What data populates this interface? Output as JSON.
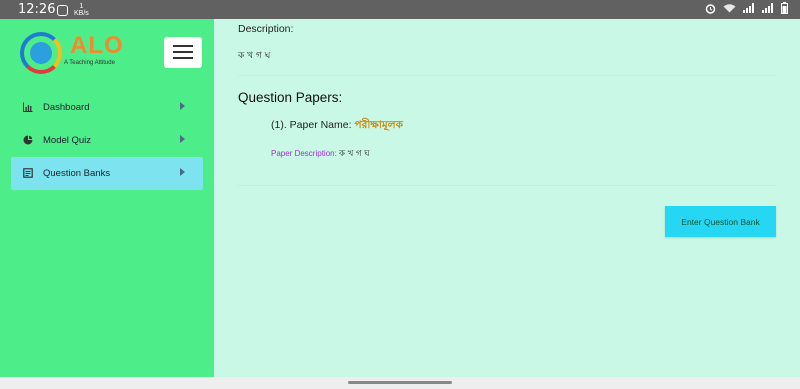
{
  "status": {
    "time": "12:26",
    "data_speed": "1\nKB/s"
  },
  "sidebar": {
    "logo_text": "ALO",
    "logo_tagline": "A Teaching Attitude",
    "items": [
      {
        "label": "Dashboard",
        "icon": "bar-chart-icon"
      },
      {
        "label": "Model Quiz",
        "icon": "pie-chart-icon"
      },
      {
        "label": "Question Banks",
        "icon": "document-icon",
        "active": true
      }
    ]
  },
  "main": {
    "description_label": "Description:",
    "description_value": "ক খ গ ঘ",
    "question_papers_title": "Question Papers:",
    "paper": {
      "name_prefix": "(1). Paper Name:",
      "name_value": "পরীক্ষামূলক",
      "desc_label": "Paper Description:",
      "desc_value": "ক খ গ ঘ"
    },
    "enter_button": "Enter Question Bank"
  },
  "colors": {
    "sidebar_bg": "#4ded89",
    "main_bg": "#c9f9e6",
    "active_item": "#7de4ef",
    "button": "#25d7f2",
    "paper_name": "#c48a12",
    "paper_desc_label": "#9b32d8"
  }
}
